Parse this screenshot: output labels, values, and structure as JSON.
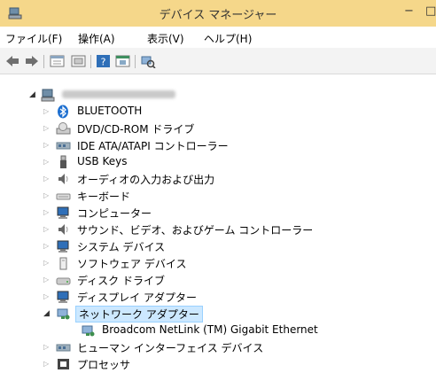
{
  "window": {
    "title": "デバイス マネージャー",
    "minimize_label": "−",
    "maximize_label": "□",
    "accent_color": "#f5d78a"
  },
  "menu": [
    {
      "label": "ファイル(F)"
    },
    {
      "label": "操作(A)"
    },
    {
      "label": "表示(V)"
    },
    {
      "label": "ヘルプ(H)"
    }
  ],
  "toolbar": {
    "buttons": [
      "back-icon",
      "forward-icon",
      "properties-list-icon",
      "device-view-icon",
      "help-icon",
      "action-icon",
      "scan-hardware-icon"
    ]
  },
  "tree": {
    "root_expander": "◢",
    "items": [
      {
        "label": "BLUETOOTH",
        "icon": "bluetooth-icon",
        "expander": "▷"
      },
      {
        "label": "DVD/CD-ROM ドライブ",
        "icon": "dvd-drive-icon",
        "expander": "▷"
      },
      {
        "label": "IDE ATA/ATAPI コントローラー",
        "icon": "ide-controller-icon",
        "expander": "▷"
      },
      {
        "label": "USB Keys",
        "icon": "usb-key-icon",
        "expander": "▷"
      },
      {
        "label": "オーディオの入力および出力",
        "icon": "speaker-icon",
        "expander": "▷"
      },
      {
        "label": "キーボード",
        "icon": "keyboard-icon",
        "expander": "▷"
      },
      {
        "label": "コンピューター",
        "icon": "computer-icon",
        "expander": "▷"
      },
      {
        "label": "サウンド、ビデオ、およびゲーム コントローラー",
        "icon": "sound-icon",
        "expander": "▷"
      },
      {
        "label": "システム デバイス",
        "icon": "system-device-icon",
        "expander": "▷"
      },
      {
        "label": "ソフトウェア デバイス",
        "icon": "software-device-icon",
        "expander": "▷"
      },
      {
        "label": "ディスク ドライブ",
        "icon": "disk-drive-icon",
        "expander": "▷"
      },
      {
        "label": "ディスプレイ アダプター",
        "icon": "display-adapter-icon",
        "expander": "▷"
      },
      {
        "label": "ネットワーク アダプター",
        "icon": "network-adapter-icon",
        "expander": "◢",
        "selected": true
      },
      {
        "label": "Broadcom NetLink (TM) Gigabit Ethernet",
        "icon": "network-card-icon",
        "expander": ""
      },
      {
        "label": "ヒューマン インターフェイス デバイス",
        "icon": "hid-icon",
        "expander": "▷"
      },
      {
        "label": "プロセッサ",
        "icon": "processor-icon",
        "expander": "▷"
      }
    ]
  }
}
